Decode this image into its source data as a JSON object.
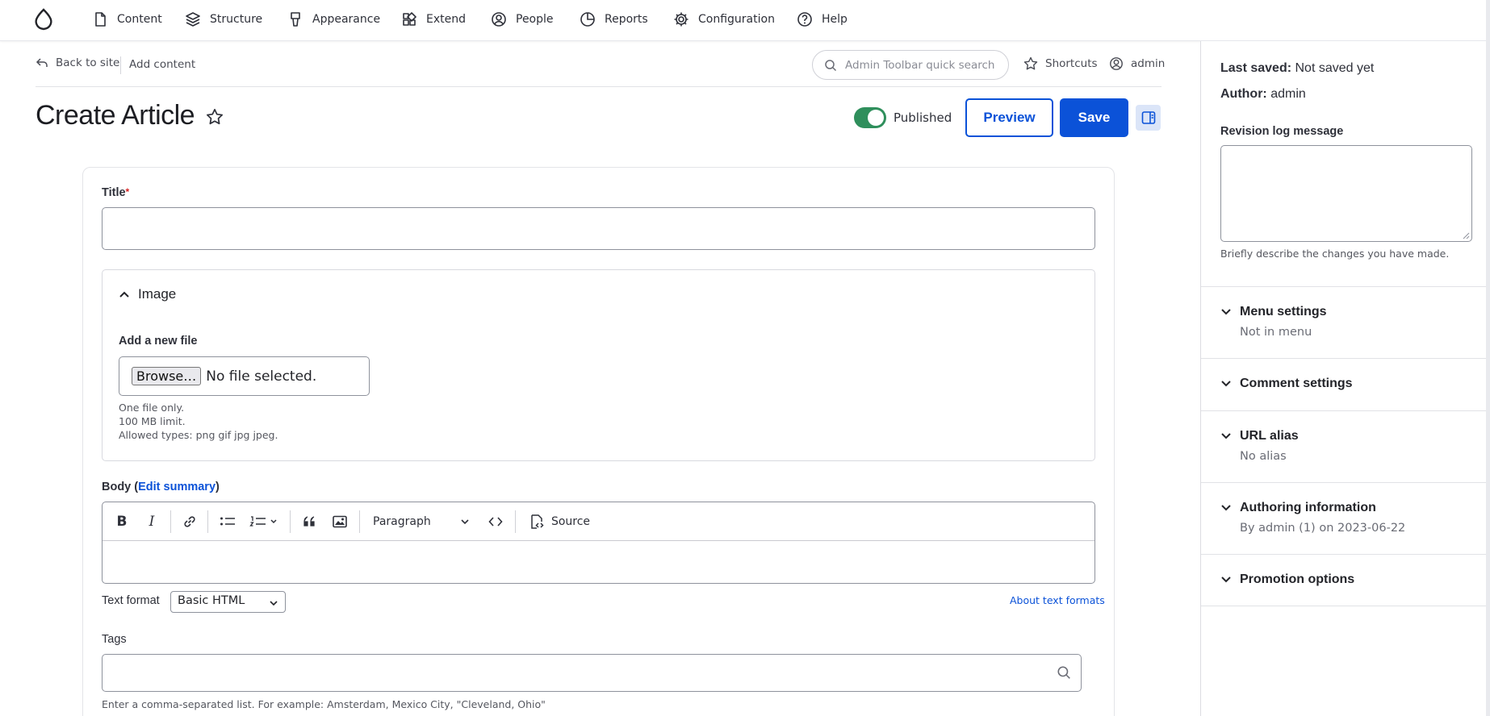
{
  "toolbar": {
    "items": [
      {
        "label": "Content",
        "icon": "document-icon"
      },
      {
        "label": "Structure",
        "icon": "layers-icon"
      },
      {
        "label": "Appearance",
        "icon": "brush-icon"
      },
      {
        "label": "Extend",
        "icon": "puzzle-icon"
      },
      {
        "label": "People",
        "icon": "user-circle-icon"
      },
      {
        "label": "Reports",
        "icon": "pie-chart-icon"
      },
      {
        "label": "Configuration",
        "icon": "gear-icon"
      },
      {
        "label": "Help",
        "icon": "question-icon"
      }
    ]
  },
  "subheader": {
    "back_label": "Back to site",
    "breadcrumb": "Add content",
    "search_placeholder": "Admin Toolbar quick search",
    "shortcuts_label": "Shortcuts",
    "user_label": "admin"
  },
  "page": {
    "title": "Create Article",
    "published_label": "Published",
    "published": true,
    "preview_label": "Preview",
    "save_label": "Save"
  },
  "form": {
    "title_label": "Title",
    "required_marker": "*",
    "image": {
      "summary": "Image",
      "add_label": "Add a new file",
      "browse_label": "Browse…",
      "no_file": "No file selected.",
      "help": [
        "One file only.",
        "100 MB limit.",
        "Allowed types: png gif jpg jpeg."
      ]
    },
    "body": {
      "label_prefix": "Body (",
      "edit_summary": "Edit summary",
      "label_suffix": ")",
      "paragraph_label": "Paragraph",
      "source_label": "Source"
    },
    "text_format": {
      "label": "Text format",
      "value": "Basic HTML",
      "about_link": "About text formats"
    },
    "tags": {
      "label": "Tags",
      "help": "Enter a comma-separated list. For example: Amsterdam, Mexico City, \"Cleveland, Ohio\""
    }
  },
  "sidebar": {
    "last_saved_label": "Last saved:",
    "last_saved_value": "Not saved yet",
    "author_label": "Author:",
    "author_value": "admin",
    "revision_label": "Revision log message",
    "revision_help": "Briefly describe the changes you have made.",
    "sections": [
      {
        "title": "Menu settings",
        "summary": "Not in menu"
      },
      {
        "title": "Comment settings",
        "summary": ""
      },
      {
        "title": "URL alias",
        "summary": "No alias"
      },
      {
        "title": "Authoring information",
        "summary": "By admin (1) on 2023-06-22"
      },
      {
        "title": "Promotion options",
        "summary": ""
      }
    ]
  },
  "colors": {
    "accent": "#0b52d8",
    "toggle_on": "#2f8f5c",
    "required": "#d72222"
  }
}
